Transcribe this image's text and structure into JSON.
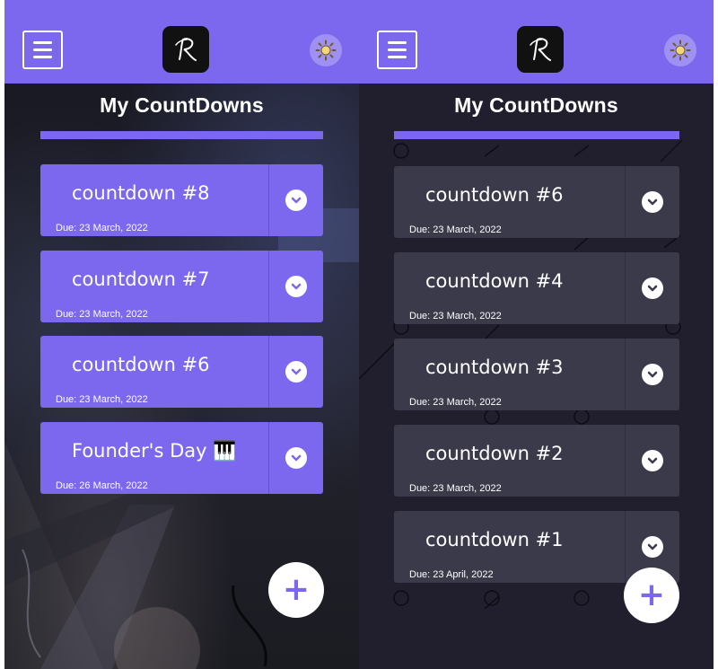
{
  "colors": {
    "accent": "#7b68ee",
    "card_dark": "#3b3a4b",
    "background_dark": "#211f2e",
    "text": "#ffffff"
  },
  "icons": {
    "menu": "hamburger-menu-icon",
    "logo": "r-logo",
    "theme": "sun-icon",
    "expand": "chevron-down-icon",
    "add": "plus-icon"
  },
  "screens": [
    {
      "title": "My CountDowns",
      "theme": "light-photo",
      "countdowns": [
        {
          "name": "countdown #8",
          "due": "Due: 23 March, 2022"
        },
        {
          "name": "countdown #7",
          "due": "Due: 23 March, 2022"
        },
        {
          "name": "countdown #6",
          "due": "Due: 23 March, 2022"
        },
        {
          "name": "Founder's Day 🎹",
          "due": "Due: 26 March, 2022"
        }
      ]
    },
    {
      "title": "My CountDowns",
      "theme": "dark",
      "countdowns": [
        {
          "name": "countdown #6",
          "due": "Due: 23 March, 2022"
        },
        {
          "name": "countdown #4",
          "due": "Due: 23 March, 2022"
        },
        {
          "name": "countdown #3",
          "due": "Due: 23 March, 2022"
        },
        {
          "name": "countdown #2",
          "due": "Due: 23 March, 2022"
        },
        {
          "name": "countdown #1",
          "due": "Due: 23 April, 2022"
        }
      ]
    }
  ],
  "fab_label": "+"
}
